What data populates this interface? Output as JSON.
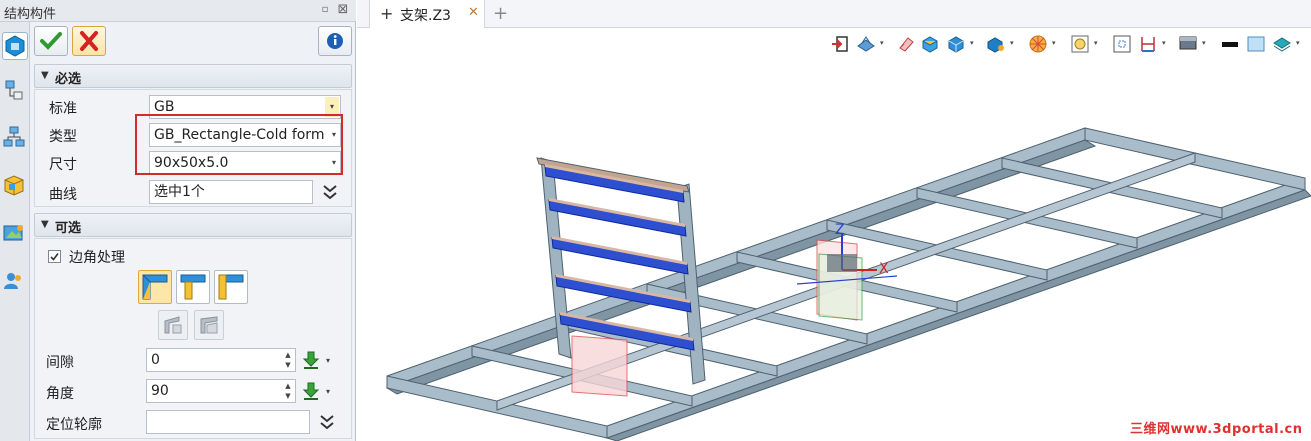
{
  "panel": {
    "title": "结构构件",
    "pin_glyph": "▫",
    "close_glyph": "⊠"
  },
  "sections": {
    "required": {
      "label": "必选",
      "rows": {
        "standard": {
          "label": "标准",
          "value": "GB"
        },
        "type": {
          "label": "类型",
          "value": "GB_Rectangle-Cold form"
        },
        "size": {
          "label": "尺寸",
          "value": "90x50x5.0"
        },
        "curve": {
          "label": "曲线",
          "value": "选中1个"
        }
      }
    },
    "optional": {
      "label": "可选",
      "corner": {
        "label": "边角处理",
        "checked": true
      },
      "gap": {
        "label": "间隙",
        "value": "0"
      },
      "angle": {
        "label": "角度",
        "value": "90"
      },
      "profile": {
        "label": "定位轮廓",
        "value": ""
      }
    }
  },
  "glyphs": {
    "triangle": "▼",
    "dropdown": "▾",
    "double_chevron": "⌄⌄",
    "spin_up": "▲",
    "spin_down": "▼"
  },
  "tabs": {
    "doc_name": "支架.Z3",
    "plus": "+",
    "close": "✕",
    "new": "+"
  },
  "viewport": {
    "axis_x": "X",
    "axis_z": "Z"
  },
  "watermark": "三维网www.3dportal.cn",
  "colors": {
    "highlight": "#d22b2b",
    "frame_fill": "#a9bcc9",
    "frame_dark": "#4e6170",
    "selected_beam": "#2d4fd0",
    "accent_green": "#3a9a3a"
  }
}
